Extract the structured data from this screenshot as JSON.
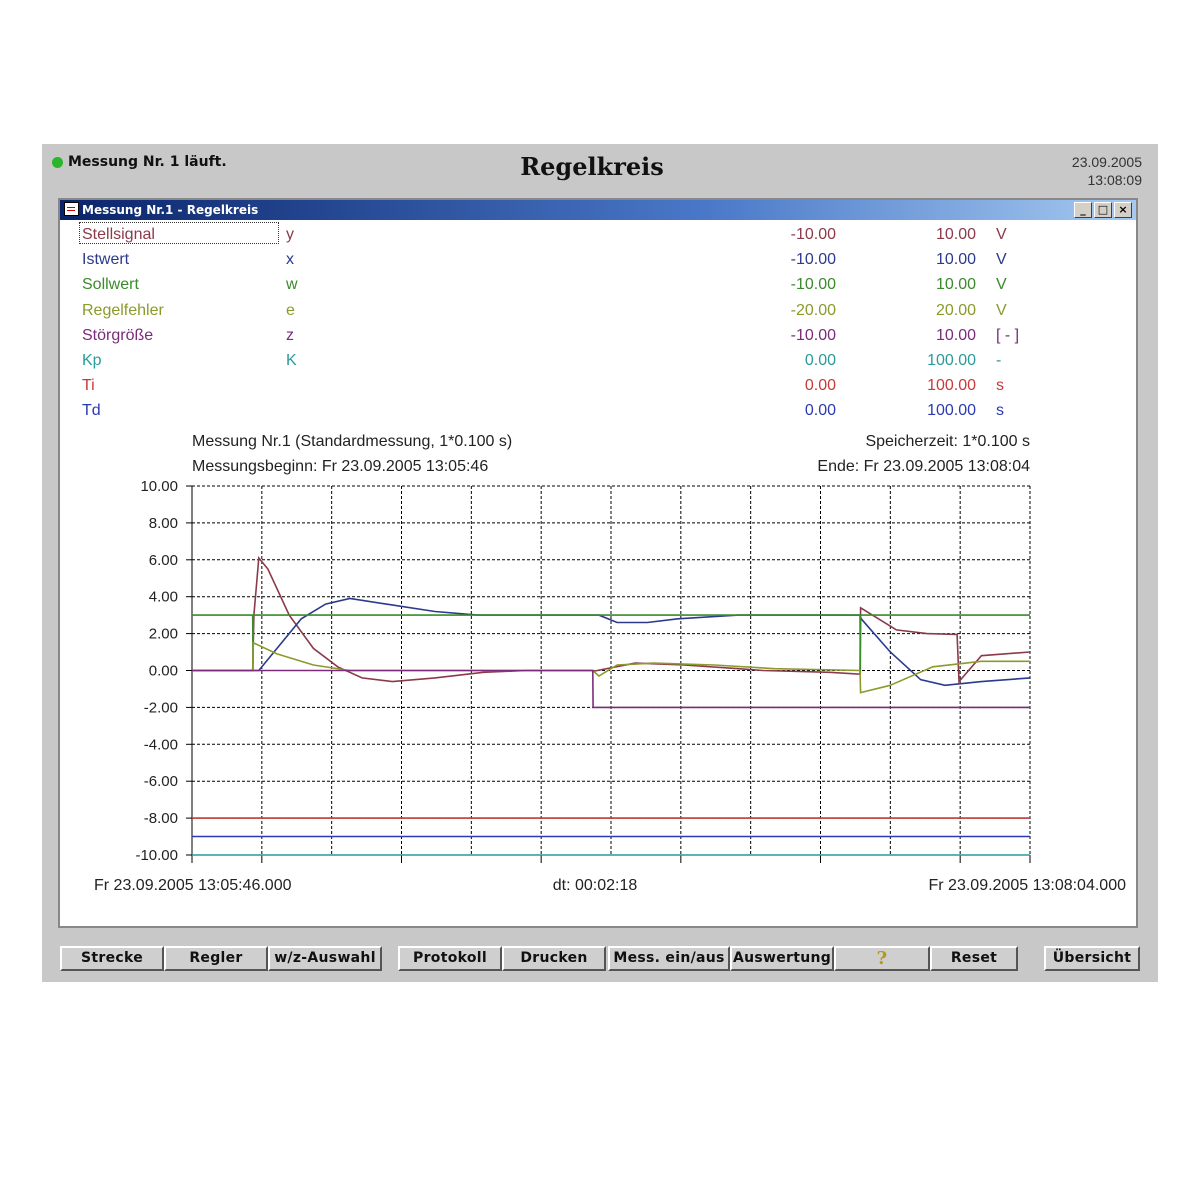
{
  "header": {
    "status": "Messung Nr. 1 läuft.",
    "title": "Regelkreis",
    "date": "23.09.2005",
    "time": "13:08:09",
    "status_color": "#2bb52b"
  },
  "window": {
    "title": "Messung Nr.1 - Regelkreis",
    "buttons": [
      "_",
      "□",
      "×"
    ]
  },
  "signals": [
    {
      "name": "Stellsignal",
      "sym": "y",
      "min": "-10.00",
      "max": "10.00",
      "unit": "V",
      "color": "#8b3a4a"
    },
    {
      "name": "Istwert",
      "sym": "x",
      "min": "-10.00",
      "max": "10.00",
      "unit": "V",
      "color": "#2b3a8b"
    },
    {
      "name": "Sollwert",
      "sym": "w",
      "min": "-10.00",
      "max": "10.00",
      "unit": "V",
      "color": "#3a8b2b"
    },
    {
      "name": "Regelfehler",
      "sym": "e",
      "min": "-20.00",
      "max": "20.00",
      "unit": "V",
      "color": "#8b9a2b"
    },
    {
      "name": "Störgröße",
      "sym": "z",
      "min": "-10.00",
      "max": "10.00",
      "unit": "[ - ]",
      "color": "#7a2b7a"
    },
    {
      "name": "Kp",
      "sym": "K",
      "min": "0.00",
      "max": "100.00",
      "unit": "-",
      "color": "#2b9a9a"
    },
    {
      "name": "Ti",
      "sym": "",
      "min": "0.00",
      "max": "100.00",
      "unit": "s",
      "color": "#c83a3a"
    },
    {
      "name": "Td",
      "sym": "",
      "min": "0.00",
      "max": "100.00",
      "unit": "s",
      "color": "#2b3ab0"
    }
  ],
  "measurement": {
    "info": "Messung Nr.1 (Standardmessung, 1*0.100 s)",
    "start": "Messungsbeginn: Fr 23.09.2005 13:05:46",
    "storage": "Speicherzeit: 1*0.100 s",
    "end": "Ende: Fr 23.09.2005 13:08:04",
    "x_start_label": "Fr 23.09.2005 13:05:46.000",
    "dt_label": "dt: 00:02:18",
    "x_end_label": "Fr 23.09.2005 13:08:04.000"
  },
  "chart_data": {
    "type": "line",
    "title": "",
    "xlabel": "",
    "ylabel": "",
    "x_range_s": [
      0,
      138
    ],
    "ylim": [
      -10,
      10
    ],
    "y_ticks": [
      "10.00",
      "8.00",
      "6.00",
      "4.00",
      "2.00",
      "0.00",
      "-2.00",
      "-4.00",
      "-6.00",
      "-8.00",
      "-10.00"
    ],
    "grid": true,
    "series": [
      {
        "name": "Stellsignal",
        "color": "#8b3a4a",
        "points": [
          [
            0,
            0
          ],
          [
            10,
            0
          ],
          [
            10.2,
            3
          ],
          [
            11,
            6.1
          ],
          [
            12.5,
            5.5
          ],
          [
            16,
            3
          ],
          [
            20,
            1.2
          ],
          [
            24,
            0.2
          ],
          [
            28,
            -0.4
          ],
          [
            33,
            -0.6
          ],
          [
            40,
            -0.4
          ],
          [
            48,
            -0.1
          ],
          [
            55,
            0
          ],
          [
            60,
            0
          ],
          [
            65.9,
            0
          ],
          [
            66,
            -0.05
          ],
          [
            73,
            0.4
          ],
          [
            81,
            0.3
          ],
          [
            90,
            0.1
          ],
          [
            94,
            0
          ],
          [
            100,
            -0.05
          ],
          [
            105,
            -0.1
          ],
          [
            110,
            -0.2
          ],
          [
            110.1,
            3.4
          ],
          [
            116,
            2.2
          ],
          [
            121,
            2.0
          ],
          [
            126,
            1.95
          ],
          [
            126.3,
            -0.6
          ],
          [
            130,
            0.8
          ],
          [
            138,
            1.0
          ]
        ]
      },
      {
        "name": "Istwert",
        "color": "#2b3a8b",
        "points": [
          [
            0,
            0
          ],
          [
            11,
            0
          ],
          [
            14,
            1.2
          ],
          [
            18,
            2.8
          ],
          [
            22,
            3.6
          ],
          [
            26,
            3.9
          ],
          [
            32,
            3.6
          ],
          [
            40,
            3.2
          ],
          [
            47,
            3.0
          ],
          [
            67,
            3.0
          ],
          [
            70,
            2.6
          ],
          [
            75,
            2.6
          ],
          [
            80,
            2.8
          ],
          [
            90,
            3.0
          ],
          [
            102,
            3.0
          ],
          [
            110,
            3.0
          ],
          [
            110.2,
            2.8
          ],
          [
            115,
            1.0
          ],
          [
            120,
            -0.5
          ],
          [
            124,
            -0.8
          ],
          [
            130,
            -0.6
          ],
          [
            138,
            -0.4
          ]
        ]
      },
      {
        "name": "Sollwert",
        "color": "#3a8b2b",
        "points": [
          [
            0,
            3
          ],
          [
            10,
            3
          ],
          [
            10.05,
            0
          ],
          [
            10.1,
            3
          ],
          [
            110,
            3
          ],
          [
            110.05,
            -0.2
          ],
          [
            110.1,
            3
          ],
          [
            138,
            3
          ]
        ]
      },
      {
        "name": "Regelfehler",
        "color": "#8b9a2b",
        "points": [
          [
            0,
            0
          ],
          [
            10,
            0
          ],
          [
            10.1,
            1.5
          ],
          [
            14,
            0.9
          ],
          [
            20,
            0.3
          ],
          [
            26,
            0
          ],
          [
            40,
            0
          ],
          [
            66,
            0
          ],
          [
            67,
            -0.3
          ],
          [
            70,
            0.3
          ],
          [
            76,
            0.4
          ],
          [
            86,
            0.3
          ],
          [
            96,
            0.1
          ],
          [
            110,
            0
          ],
          [
            110.1,
            -1.2
          ],
          [
            115,
            -0.8
          ],
          [
            122,
            0.2
          ],
          [
            130,
            0.5
          ],
          [
            138,
            0.5
          ]
        ]
      },
      {
        "name": "Störgröße",
        "color": "#7a2b7a",
        "points": [
          [
            0,
            0
          ],
          [
            66,
            0
          ],
          [
            66.05,
            -2
          ],
          [
            138,
            -2
          ]
        ]
      },
      {
        "name": "Kp",
        "color": "#2b9a9a",
        "points": [
          [
            0,
            -10
          ],
          [
            138,
            -10
          ]
        ]
      },
      {
        "name": "Ti",
        "color": "#c83a3a",
        "points": [
          [
            0,
            -8
          ],
          [
            138,
            -8
          ]
        ]
      },
      {
        "name": "Td",
        "color": "#2b3ab0",
        "points": [
          [
            0,
            -9
          ],
          [
            138,
            -9
          ]
        ]
      }
    ]
  },
  "buttons": [
    {
      "label": "Strecke"
    },
    {
      "label": "Regler"
    },
    {
      "label": "w/z-Auswahl"
    },
    {
      "label": "Protokoll"
    },
    {
      "label": "Drucken"
    },
    {
      "label": "Mess. ein/aus"
    },
    {
      "label": "Auswertung"
    },
    {
      "label": "",
      "icon": "help-icon"
    },
    {
      "label": "Reset"
    },
    {
      "label": "Übersicht"
    }
  ]
}
